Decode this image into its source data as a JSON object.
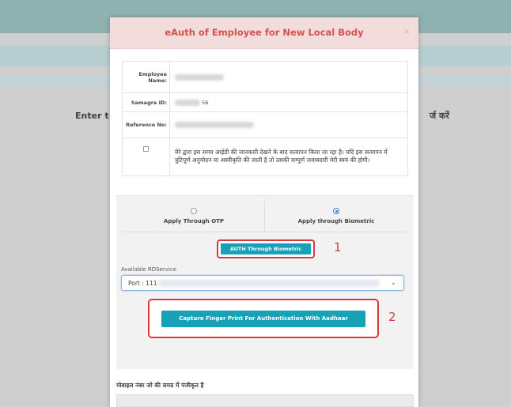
{
  "background": {
    "left_text": "Enter t",
    "right_text": "र्ज करें"
  },
  "modal": {
    "title": "eAuth of Employee for New Local Body",
    "close_symbol": "×",
    "fields": {
      "employee_name_label": "Employee Name:",
      "samagra_label": "Samagra ID:",
      "samagra_value_visible": "56",
      "reference_label": "Reference No:"
    },
    "consent_text": "मेरे द्वारा इस समय आईडी की जानकारी देखने के बाद सत्यापन किया जा रहा है। यदि इस सत्यापन में त्रुटिपूर्ण अनुमोदन या अस्वीकृति की जाती है तो उसकी सम्पूर्ण जवाबदारी मेरी स्वयं की होगी।",
    "auth_options": [
      {
        "label": "Apply Through OTP",
        "selected": false
      },
      {
        "label": "Apply through Biometric",
        "selected": true
      }
    ],
    "auth_button_label": "AUTH Through Biometric",
    "callout_1": "1",
    "rdservice": {
      "label": "Available RDService",
      "selected_value": "Port : 111"
    },
    "capture_button_label": "Capture Finger Print For Authentication With Aadhaar",
    "callout_2": "2",
    "bottom_label": "मोबाइल नंबर जो की समग्र में पंजीकृत है"
  },
  "colors": {
    "title_red": "#d0544f",
    "header_pink": "#f3dcdc",
    "button_teal": "#17a2b8",
    "highlight_red": "#d9393e",
    "radio_blue": "#2a7bd0"
  }
}
